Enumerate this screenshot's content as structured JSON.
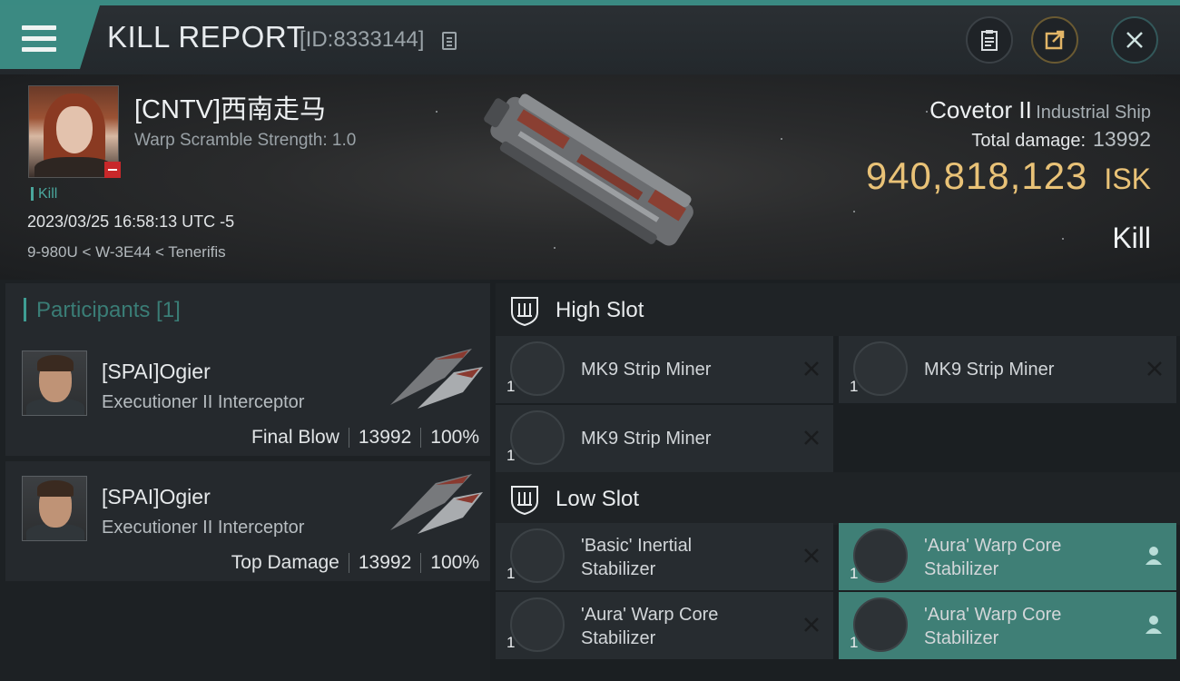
{
  "header": {
    "title": "KILL REPORT",
    "report_id": "[ID:8333144]"
  },
  "victim": {
    "name": "[CNTV]西南走马",
    "warp_scramble": "Warp Scramble Strength: 1.0",
    "type_tag": "Kill",
    "datetime": "2023/03/25 16:58:13 UTC -5",
    "location": "9-980U < W-3E44 < Tenerifis",
    "ship_name": "Covetor II",
    "ship_class": "Industrial Ship",
    "total_damage_label": "Total damage:",
    "total_damage": "13992",
    "isk_value": "940,818,123",
    "isk_unit": "ISK",
    "result": "Kill"
  },
  "participants": {
    "header": "Participants [1]",
    "rows": [
      {
        "name": "[SPAI]Ogier",
        "ship": "Executioner II Interceptor",
        "role": "Final Blow",
        "damage": "13992",
        "percent": "100%"
      },
      {
        "name": "[SPAI]Ogier",
        "ship": "Executioner II Interceptor",
        "role": "Top Damage",
        "damage": "13992",
        "percent": "100%"
      }
    ]
  },
  "fittings": {
    "high_slot": {
      "label": "High Slot",
      "modules": [
        {
          "qty": "1",
          "name": "MK9 Strip Miner",
          "status": "destroyed"
        },
        {
          "qty": "1",
          "name": "MK9 Strip Miner",
          "status": "destroyed"
        },
        {
          "qty": "1",
          "name": "MK9 Strip Miner",
          "status": "destroyed"
        }
      ]
    },
    "low_slot": {
      "label": "Low Slot",
      "modules": [
        {
          "qty": "1",
          "name_line1": "'Basic' Inertial",
          "name_line2": "Stabilizer",
          "status": "destroyed"
        },
        {
          "qty": "1",
          "name_line1": "'Aura' Warp Core",
          "name_line2": "Stabilizer",
          "status": "dropped"
        },
        {
          "qty": "1",
          "name_line1": "'Aura' Warp Core",
          "name_line2": "Stabilizer",
          "status": "destroyed"
        },
        {
          "qty": "1",
          "name_line1": "'Aura' Warp Core",
          "name_line2": "Stabilizer",
          "status": "dropped"
        }
      ]
    }
  },
  "icons": {
    "menu": "hamburger-menu-icon",
    "copy": "copy-icon",
    "clipboard": "clipboard-icon",
    "share": "share-icon",
    "close": "close-icon"
  },
  "colors": {
    "accent_teal": "#3b8a82",
    "isk_gold": "#e9c277",
    "fitted_bg": "#3f7f76"
  }
}
